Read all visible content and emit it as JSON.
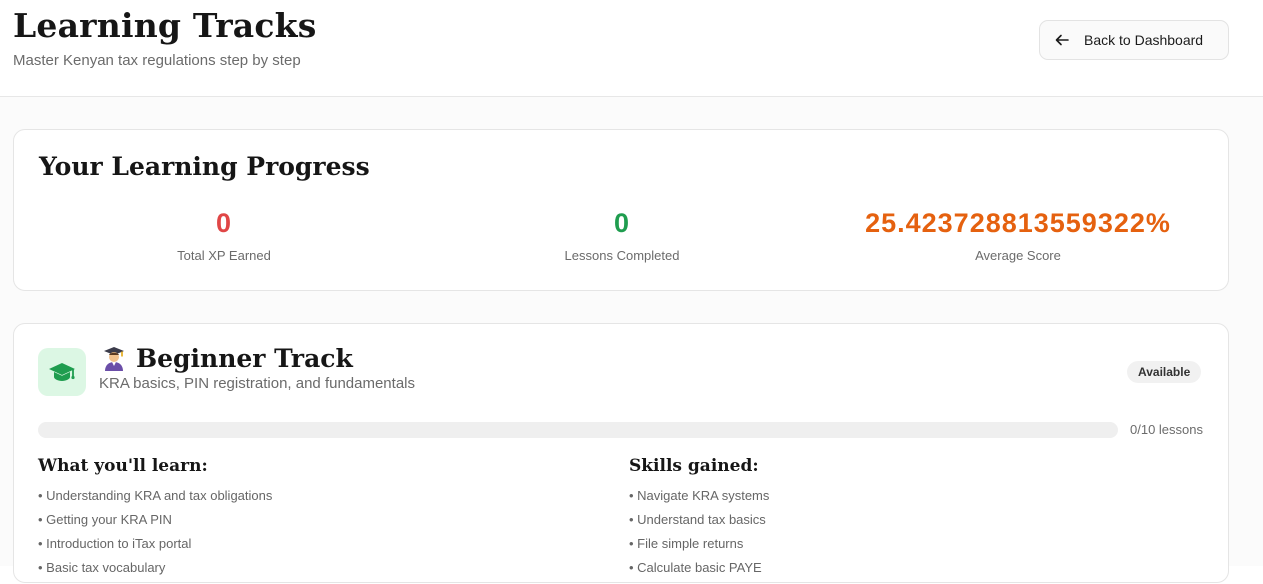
{
  "header": {
    "title": "Learning Tracks",
    "subtitle": "Master Kenyan tax regulations step by step",
    "back_button": "Back to Dashboard"
  },
  "progress": {
    "heading": "Your Learning Progress",
    "stats": [
      {
        "value": "0",
        "label": "Total XP Earned",
        "color": "#e04646"
      },
      {
        "value": "0",
        "label": "Lessons Completed",
        "color": "#1f9d4f"
      },
      {
        "value": "25.423728813559322%",
        "label": "Average Score",
        "color": "#e5610f"
      }
    ]
  },
  "track": {
    "icon": "graduation-cap-icon",
    "emoji": "student-emoji-icon",
    "title": "Beginner Track",
    "description": "KRA basics, PIN registration, and fundamentals",
    "badge": "Available",
    "progress_fraction": 0,
    "lessons_label": "0/10 lessons",
    "learn_heading": "What you'll learn:",
    "learn_items": [
      "• Understanding KRA and tax obligations",
      "• Getting your KRA PIN",
      "• Introduction to iTax portal",
      "• Basic tax vocabulary"
    ],
    "skills_heading": "Skills gained:",
    "skills_items": [
      "• Navigate KRA systems",
      "• Understand tax basics",
      "• File simple returns",
      "• Calculate basic PAYE"
    ]
  },
  "colors": {
    "accent_green": "#1f9d4f",
    "accent_red": "#e04646",
    "accent_orange": "#e5610f",
    "icon_bg": "#dcf7e4"
  }
}
